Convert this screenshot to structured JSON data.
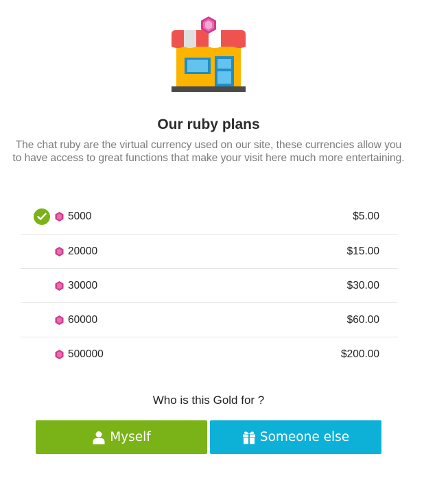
{
  "header": {
    "title": "Our ruby plans",
    "description": "The chat ruby are the virtual currency used on our site, these currencies allow you to have access to great functions that make your visit here much more entertaining."
  },
  "plans": [
    {
      "amount": "5000",
      "price": "$5.00",
      "selected": true
    },
    {
      "amount": "20000",
      "price": "$15.00",
      "selected": false
    },
    {
      "amount": "30000",
      "price": "$30.00",
      "selected": false
    },
    {
      "amount": "60000",
      "price": "$60.00",
      "selected": false
    },
    {
      "amount": "500000",
      "price": "$200.00",
      "selected": false
    }
  ],
  "recipient": {
    "question": "Who is this Gold for ?",
    "myself_label": "Myself",
    "someone_else_label": "Someone else"
  },
  "icons": {
    "illustration": "shop-storefront-with-gem",
    "selected": "check-circle-icon",
    "currency": "ruby-gem-icon",
    "myself": "user-icon",
    "someone_else": "gift-icon"
  },
  "colors": {
    "green": "#7ab317",
    "blue": "#0db1d8",
    "gem": "#d23a8c",
    "awning_red": "#ef5350",
    "shop_yellow": "#fbb400"
  }
}
